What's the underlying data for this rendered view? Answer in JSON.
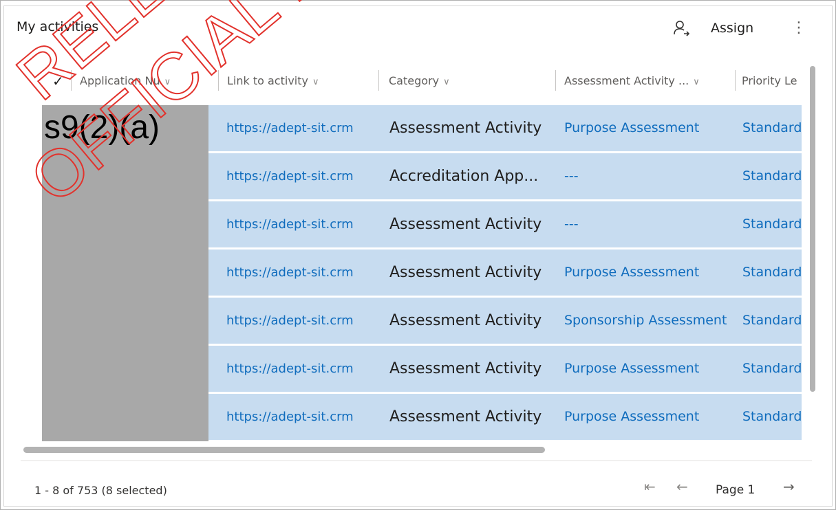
{
  "panel": {
    "title": "My activities"
  },
  "toolbar": {
    "assign_label": "Assign",
    "more_glyph": "⋮"
  },
  "icons": {
    "assign": "person-assign-icon",
    "more": "more-vertical-icon",
    "check": "checkmark-icon",
    "first": "first-page-icon",
    "prev": "previous-page-icon",
    "next": "next-page-icon"
  },
  "grid": {
    "select_all_glyph": "✓",
    "headers": [
      "Application Nu",
      "Link to activity",
      "Category",
      "Assessment Activity ...",
      "Priority Le"
    ],
    "rows": [
      {
        "link": "https://adept-sit.crm",
        "category": "Assessment Activity",
        "assessment": "Purpose Assessment",
        "priority": "Standard"
      },
      {
        "link": "https://adept-sit.crm",
        "category": "Accreditation App...",
        "assessment": "---",
        "priority": "Standard"
      },
      {
        "link": "https://adept-sit.crm",
        "category": "Assessment Activity",
        "assessment": "---",
        "priority": "Standard"
      },
      {
        "link": "https://adept-sit.crm",
        "category": "Assessment Activity",
        "assessment": "Purpose Assessment",
        "priority": "Standard"
      },
      {
        "link": "https://adept-sit.crm",
        "category": "Assessment Activity",
        "assessment": "Sponsorship Assessment",
        "priority": "Standard"
      },
      {
        "link": "https://adept-sit.crm",
        "category": "Assessment Activity",
        "assessment": "Purpose Assessment",
        "priority": "Standard"
      },
      {
        "link": "https://adept-sit.crm",
        "category": "Assessment Activity",
        "assessment": "Purpose Assessment",
        "priority": "Standard"
      }
    ]
  },
  "redaction": {
    "label": "s9(2)(a)"
  },
  "footer": {
    "record_count": "1 - 8 of 753 (8 selected)",
    "page_label": "Page 1",
    "first_glyph": "⇤",
    "prev_glyph": "←",
    "next_glyph": "→"
  },
  "watermark": {
    "line1": "RELEASED UNDER THE",
    "line2": "OFFICIAL INFORMATION ACT"
  },
  "colors": {
    "row_selected": "#c7dcf0",
    "link": "#0f6cbd",
    "redaction": "#a8a8a8"
  }
}
